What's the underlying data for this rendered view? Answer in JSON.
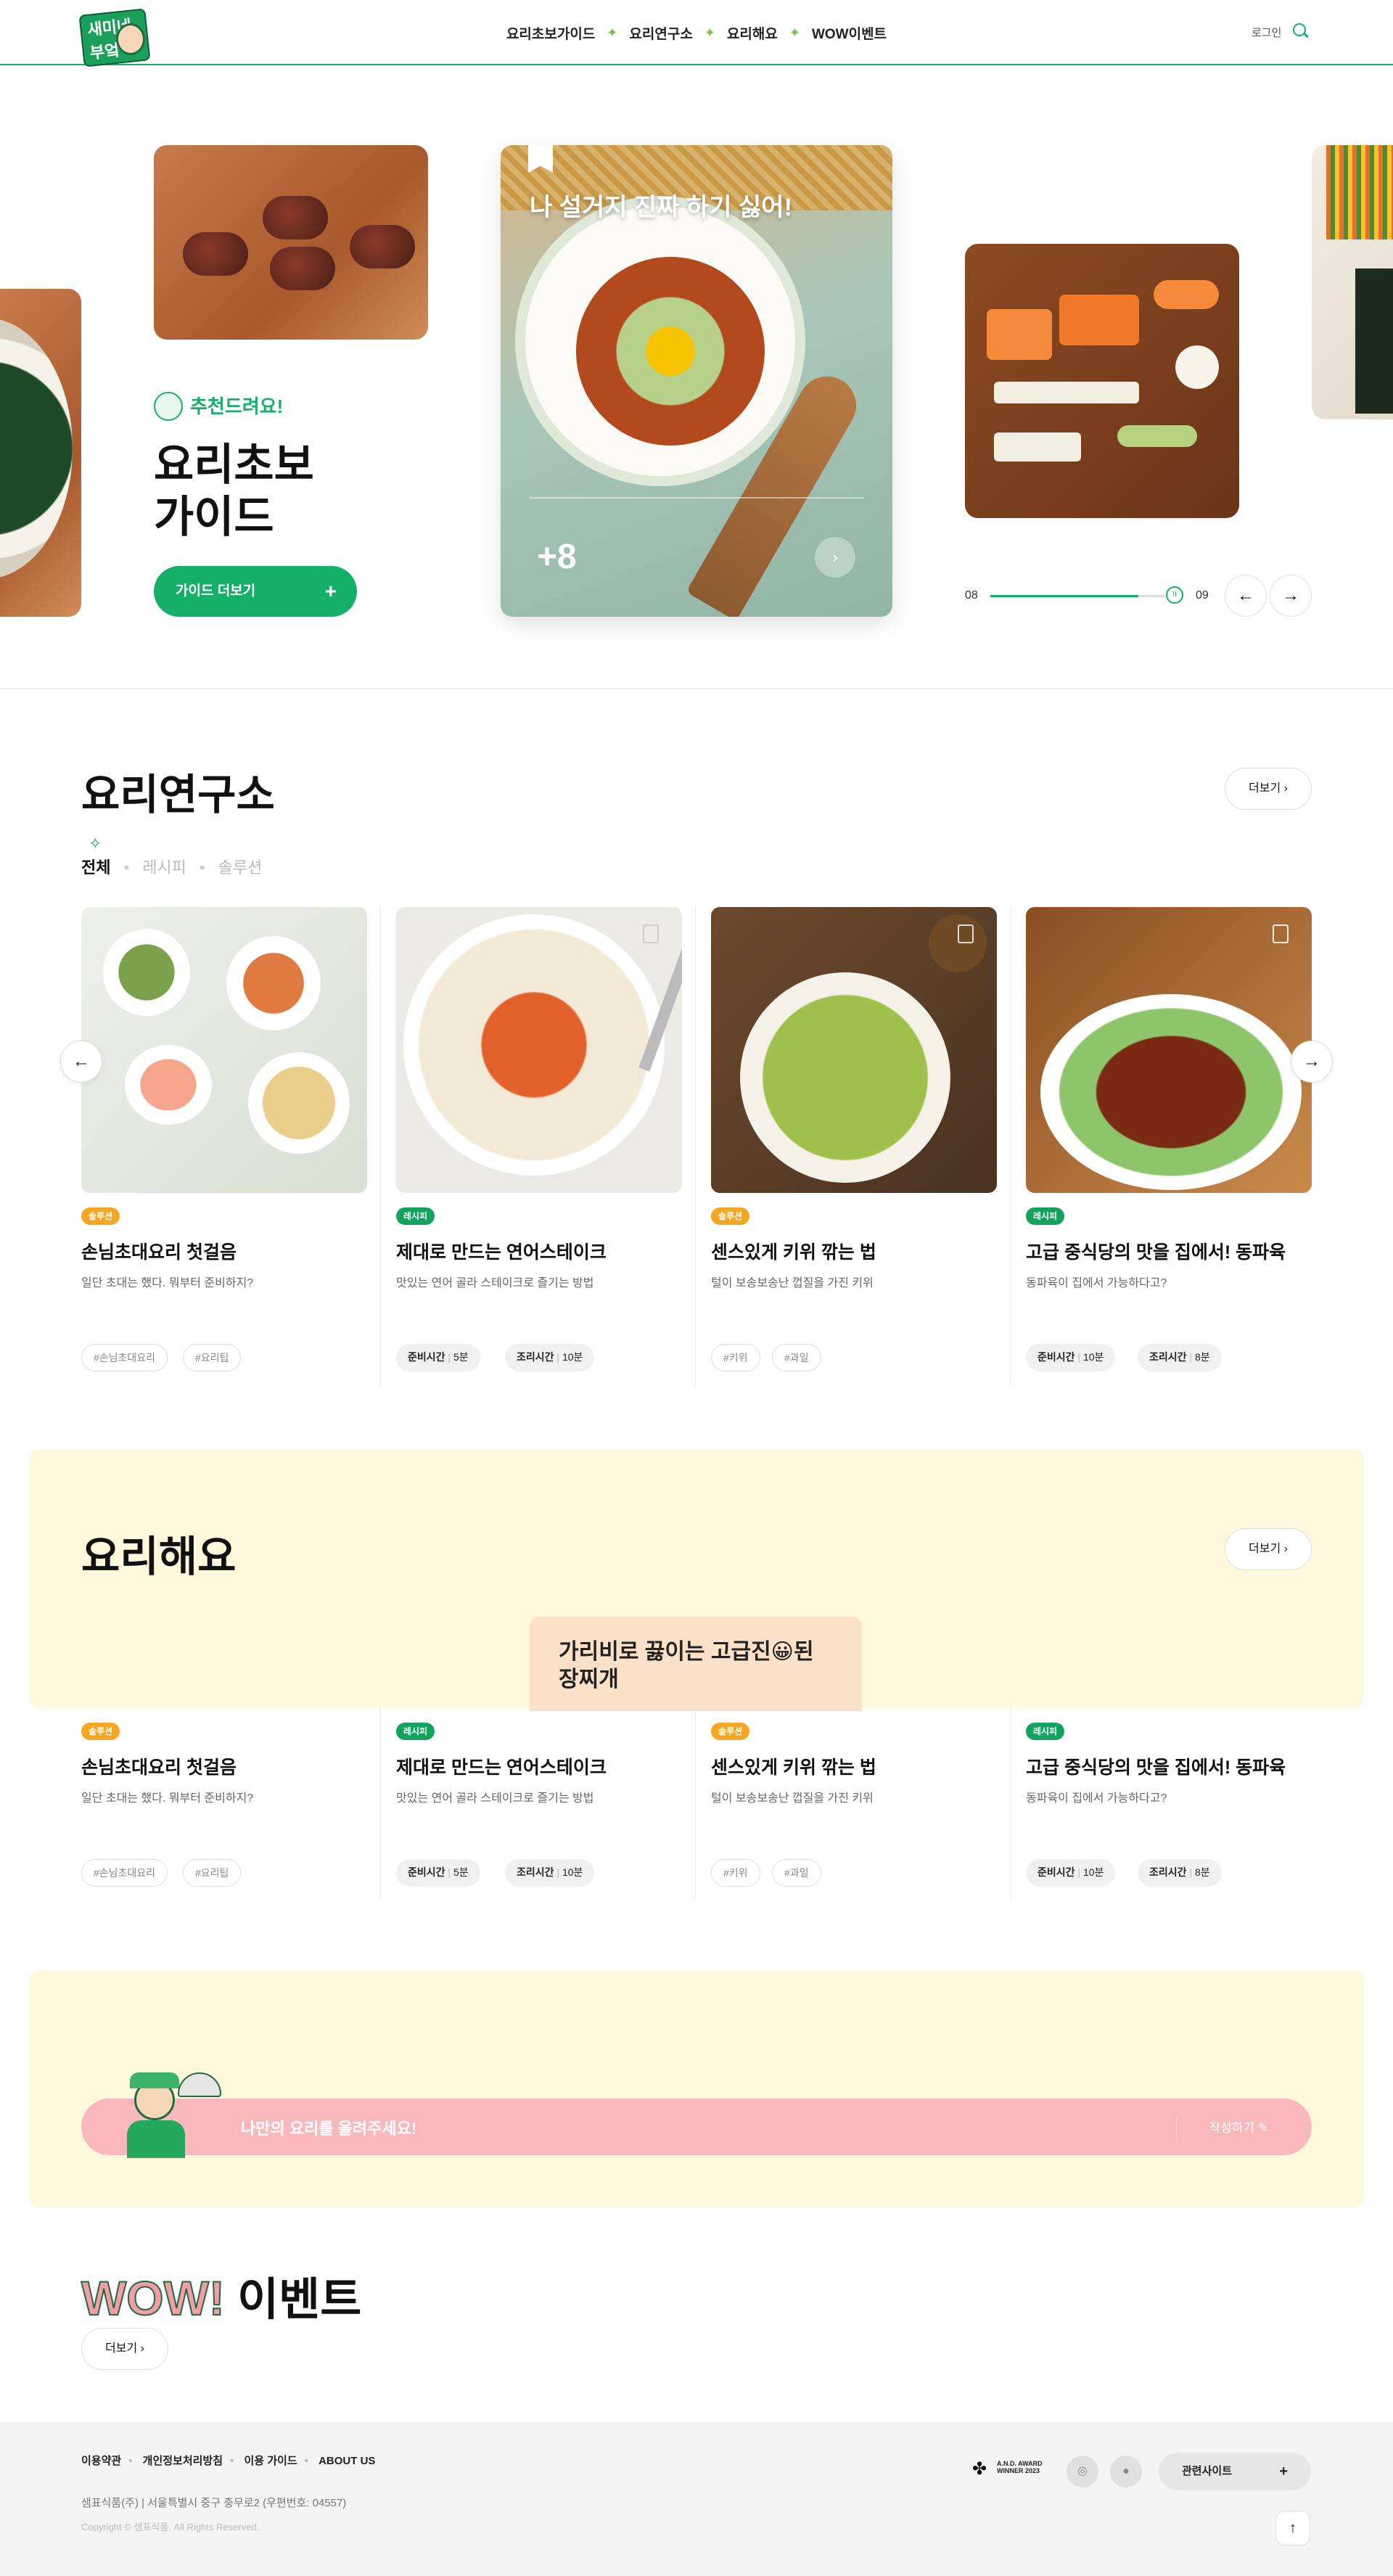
{
  "header": {
    "logo": "새미네부엌",
    "nav": [
      "요리초보가이드",
      "요리연구소",
      "요리해요",
      "WOW이벤트"
    ],
    "login": "로그인"
  },
  "hero": {
    "recommend": "추천드려요!",
    "title_line1": "요리초보",
    "title_line2": "가이드",
    "guide_button": "가이드 더보기",
    "card_title": "나 설거지 진짜 하기 싫어!",
    "card_count": "+8",
    "progress_current": "08",
    "progress_next": "09",
    "progress_fraction": 0.85
  },
  "lab": {
    "title": "요리연구소",
    "more": "더보기",
    "tabs": [
      "전체",
      "레시피",
      "솔루션"
    ],
    "cards": [
      {
        "badge": "솔루션",
        "title": "손님초대요리 첫걸음",
        "desc": "일단 초대는 했다. 뭐부터 준비하지?",
        "chips": [
          "#손님초대요리",
          "#요리팁"
        ]
      },
      {
        "badge": "레시피",
        "title": "제대로 만드는 연어스테이크",
        "desc": "맛있는 연어 골라 스테이크로 즐기는 방법",
        "chips": [
          [
            "준비시간",
            "5분"
          ],
          [
            "조리시간",
            "10분"
          ]
        ]
      },
      {
        "badge": "솔루션",
        "title": "센스있게 키위 깎는 법",
        "desc": "털이 보송보송난 껍질을 가진 키위",
        "chips": [
          "#키위",
          "#과일"
        ]
      },
      {
        "badge": "레시피",
        "title": "고급 중식당의 맛을 집에서! 동파육",
        "desc": "동파육이 집에서 가능하다고?",
        "chips": [
          [
            "준비시간",
            "10분"
          ],
          [
            "조리시간",
            "8분"
          ]
        ]
      }
    ]
  },
  "cook": {
    "title": "요리해요",
    "more": "더보기",
    "tooltip": "가리비로 끓이는 고급진😀된장찌개"
  },
  "upload": {
    "text": "나만의 요리를 올려주세요!",
    "write": "작성하기"
  },
  "wow": {
    "logo": "WOW!",
    "title": "이벤트",
    "more": "더보기"
  },
  "footer": {
    "links": [
      "이용약관",
      "개인정보처리방침",
      "이용 가이드",
      "ABOUT US"
    ],
    "address": "샘표식품(주) | 서울특별시 중구 충무로2 (우편번호: 04557)",
    "copyright": "Copyright © 샘표식품. All Rights Reserved.",
    "award": "A.N.D. AWARD WINNER 2023",
    "related": "관련사이트"
  },
  "colors": {
    "accent": "#14b06a",
    "solution": "#f5a623",
    "pink": "#f8b8bc",
    "cream": "#fff8dc"
  }
}
